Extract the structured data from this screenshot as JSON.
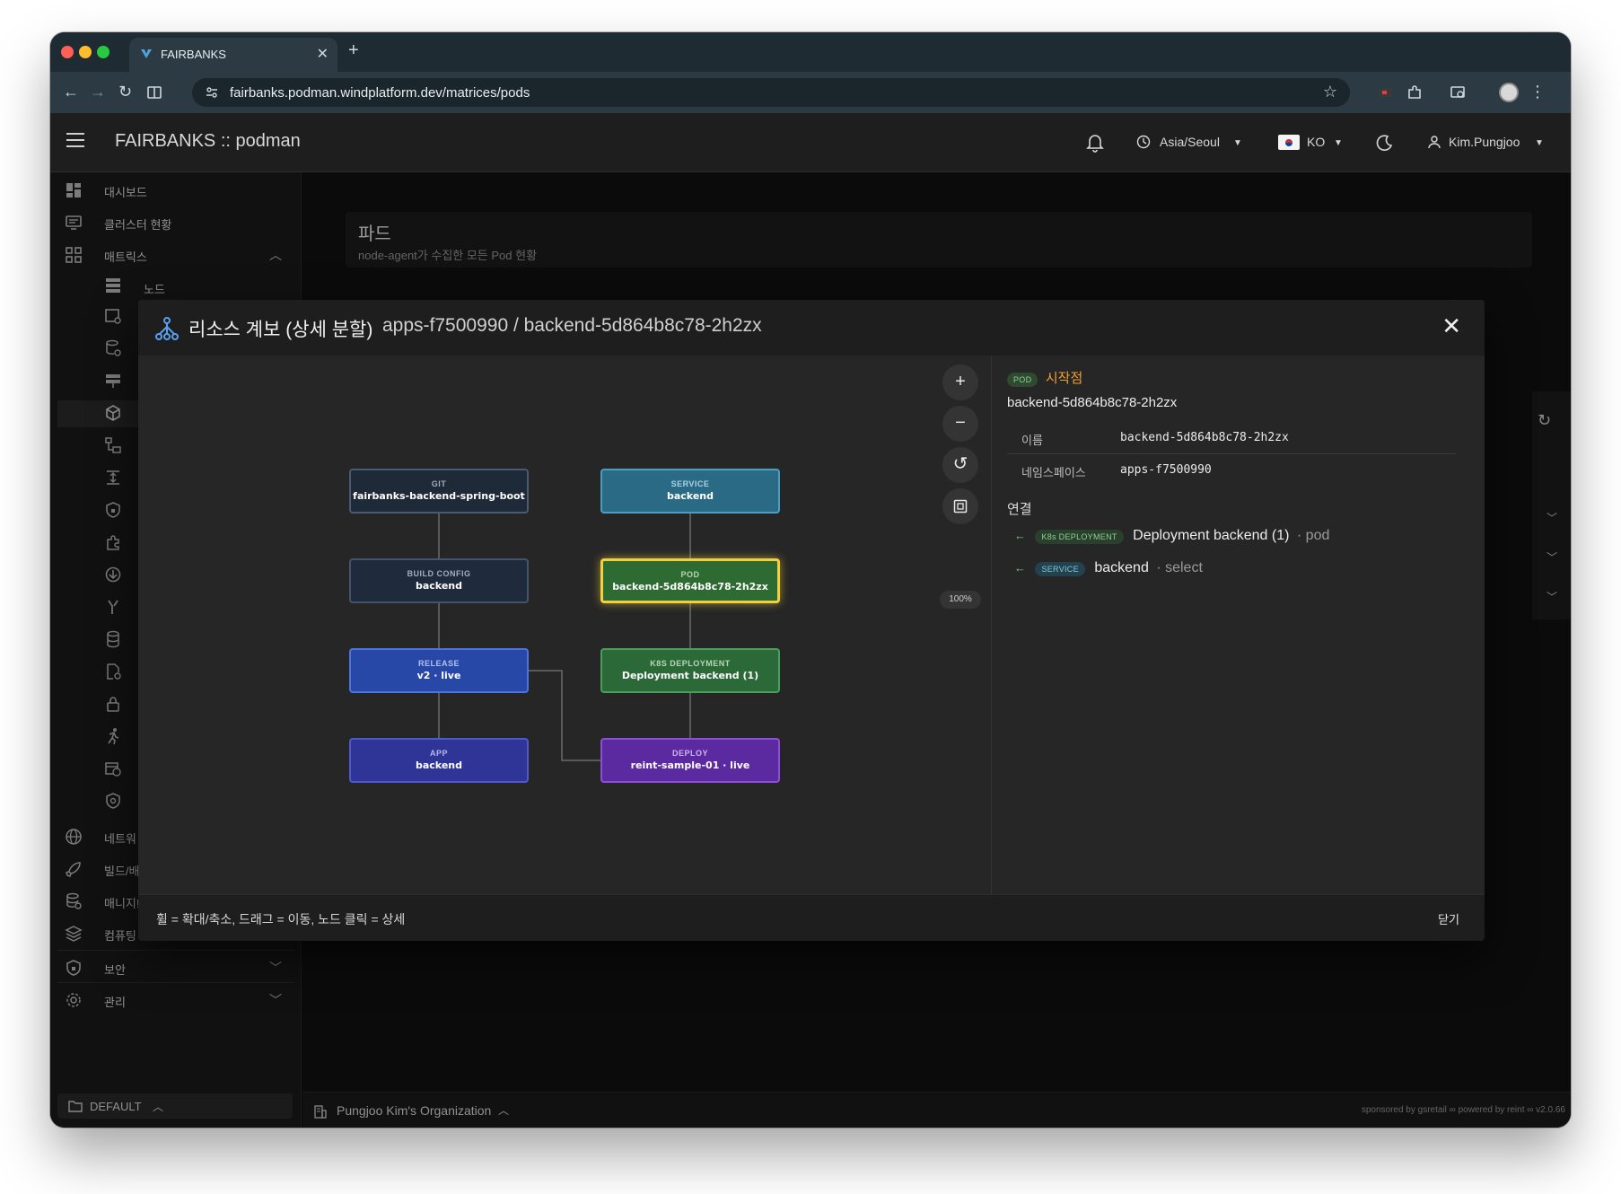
{
  "browser": {
    "tab_title": "FAIRBANKS",
    "url": "fairbanks.podman.windplatform.dev/matrices/pods"
  },
  "header": {
    "app_title": "FAIRBANKS :: podman",
    "timezone": "Asia/Seoul",
    "language": "KO",
    "user": "Kim.Pungjoo"
  },
  "sidebar": {
    "dashboard": "대시보드",
    "cluster_status": "클러스터 현황",
    "matrix": "매트릭스",
    "node": "노드",
    "network": "네트워",
    "build": "빌드/배",
    "manage": "매니지!",
    "computing": "컴퓨팅",
    "security": "보안",
    "admin": "관리",
    "workspace": "DEFAULT"
  },
  "page": {
    "title": "파드",
    "subtitle": "node-agent가 수집한 모든 Pod 현황"
  },
  "footer": {
    "org": "Pungjoo Kim's Organization",
    "credit": "sponsored by gsretail ∞ powered by reint ∞ v2.0.66"
  },
  "dialog": {
    "title": "리소스 계보 (상세 분할)",
    "path": "apps-f7500990 / backend-5d864b8c78-2h2zx",
    "zoom": "100%",
    "hint": "휠 = 확대/축소, 드래그 = 이동, 노드 클릭 = 상세",
    "close_label": "닫기",
    "nodes": [
      {
        "kind": "GIT",
        "name": "fairbanks-backend-spring-boot"
      },
      {
        "kind": "SERVICE",
        "name": "backend"
      },
      {
        "kind": "BUILD CONFIG",
        "name": "backend"
      },
      {
        "kind": "POD",
        "name": "backend-5d864b8c78-2h2zx"
      },
      {
        "kind": "RELEASE",
        "name": "v2 · live"
      },
      {
        "kind": "K8S DEPLOYMENT",
        "name": "Deployment backend (1)"
      },
      {
        "kind": "APP",
        "name": "backend"
      },
      {
        "kind": "DEPLOY",
        "name": "reint-sample-01 · live"
      }
    ],
    "detail": {
      "kind_badge": "POD",
      "origin": "시작점",
      "name": "backend-5d864b8c78-2h2zx",
      "fields": [
        {
          "label": "이름",
          "value": "backend-5d864b8c78-2h2zx"
        },
        {
          "label": "네임스페이스",
          "value": "apps-f7500990"
        }
      ],
      "links_title": "연결",
      "links": [
        {
          "arrow": "←",
          "badge": "K8s DEPLOYMENT",
          "name": "Deployment backend (1)",
          "rel": "· pod"
        },
        {
          "arrow": "←",
          "badge": "SERVICE",
          "name": "backend",
          "rel": "· select"
        }
      ]
    }
  },
  "colors": {
    "git": "#1e2a38",
    "service": "#2b6a84",
    "build_config": "#1f2a3d",
    "pod": "#2e6b32",
    "pod_highlight": "#f4d03f",
    "release": "#2848a8",
    "k8s_deployment": "#2b6a38",
    "app": "#2f3596",
    "deploy": "#5b2aa0",
    "origin_text": "#f0a030"
  }
}
